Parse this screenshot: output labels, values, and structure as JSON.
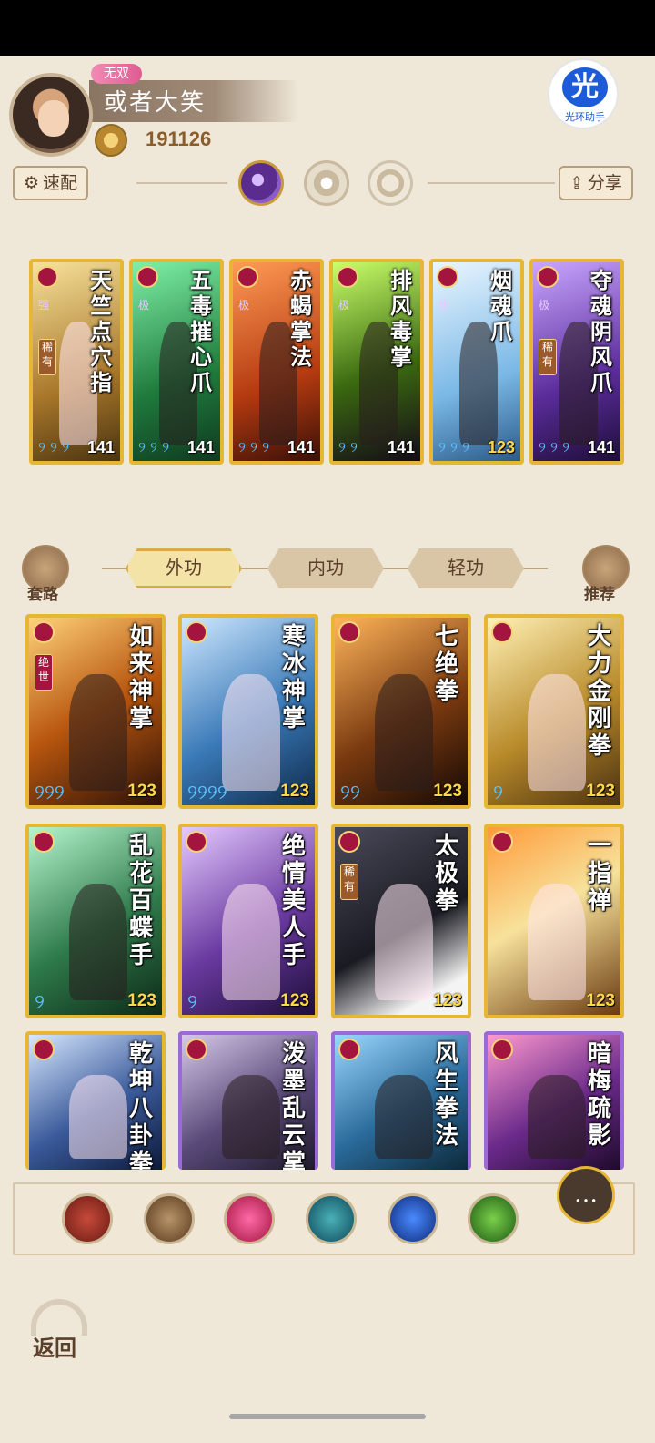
{
  "player": {
    "name": "或者大笑",
    "title": "无双",
    "power": "191126"
  },
  "helper": {
    "glyph": "光",
    "label": "光环助手"
  },
  "toolbar": {
    "quick_label": "速配",
    "share_label": "分享"
  },
  "equipped": [
    {
      "name": "天竺点穴指",
      "tier": "强",
      "rarity": "稀有",
      "level": "141"
    },
    {
      "name": "五毒摧心爪",
      "tier": "极",
      "rarity": "",
      "level": "141"
    },
    {
      "name": "赤蝎掌法",
      "tier": "极",
      "rarity": "",
      "level": "141"
    },
    {
      "name": "排风毒掌",
      "tier": "极",
      "rarity": "",
      "level": "141"
    },
    {
      "name": "烟魂爪",
      "tier": "极",
      "rarity": "",
      "level": "123"
    },
    {
      "name": "夺魂阴风爪",
      "tier": "极",
      "rarity": "稀有",
      "level": "141"
    }
  ],
  "categories": {
    "left_label": "套路",
    "right_label": "推荐",
    "tabs": [
      "外功",
      "内功",
      "轻功"
    ],
    "active_tab": "外功"
  },
  "skills": [
    {
      "name": "如来神掌",
      "tag": "绝世",
      "level": "123"
    },
    {
      "name": "寒冰神掌",
      "tag": "",
      "level": "123"
    },
    {
      "name": "七绝拳",
      "tag": "",
      "level": "123"
    },
    {
      "name": "大力金刚拳",
      "tag": "",
      "level": "123"
    },
    {
      "name": "乱花百蝶手",
      "tag": "",
      "level": "123"
    },
    {
      "name": "绝情美人手",
      "tag": "",
      "level": "123"
    },
    {
      "name": "太极拳",
      "tag": "稀有",
      "level": "123"
    },
    {
      "name": "一指禅",
      "tag": "",
      "level": "123"
    },
    {
      "name": "乾坤八卦拳",
      "tag": "",
      "level": ""
    },
    {
      "name": "泼墨乱云掌",
      "tag": "",
      "level": ""
    },
    {
      "name": "风生拳法",
      "tag": "",
      "level": ""
    },
    {
      "name": "暗梅疏影",
      "tag": "",
      "level": ""
    }
  ],
  "filters": [
    "sword-icon",
    "blade-icon",
    "fist-icon",
    "palm-icon",
    "taiji-icon",
    "hand-icon"
  ],
  "back_label": "返回",
  "colors": {
    "gold_border": "#e5b735",
    "purple_border": "#9a6ad8",
    "level_gold": "#ffd84a"
  }
}
